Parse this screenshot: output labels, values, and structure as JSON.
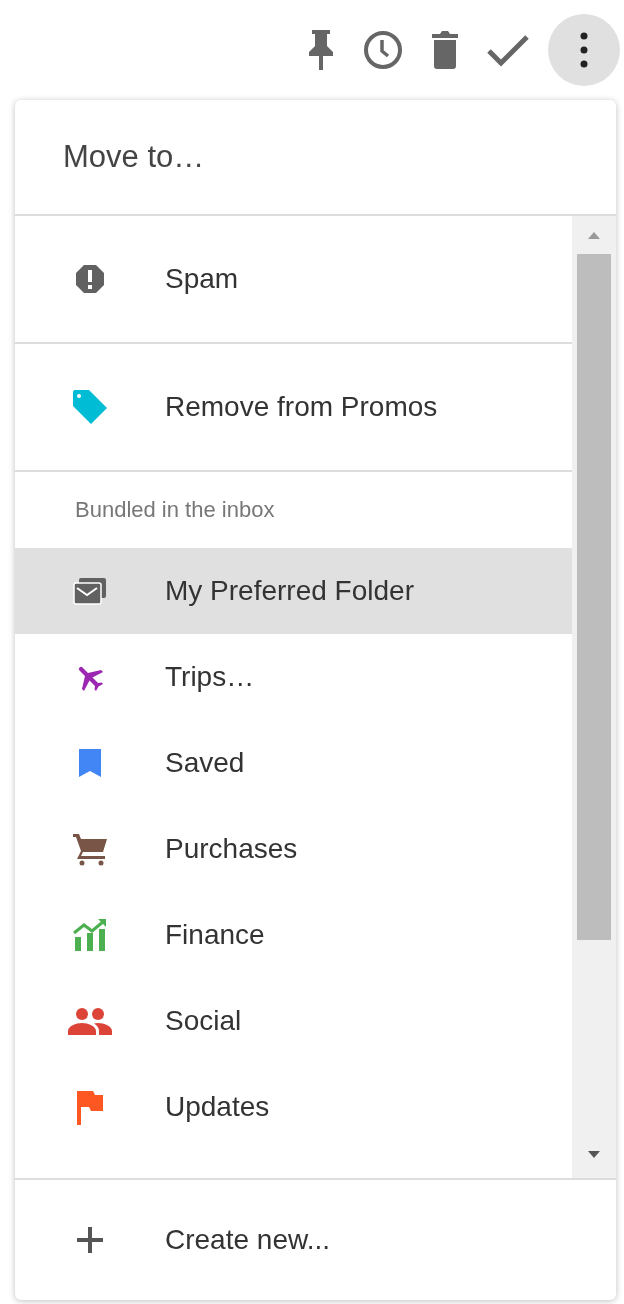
{
  "menu": {
    "title": "Move to…",
    "actions": [
      {
        "label": "Spam",
        "color": "#616161"
      },
      {
        "label": "Remove from Promos",
        "color": "#00bcd4"
      }
    ],
    "section_label": "Bundled in the inbox",
    "folders": [
      {
        "label": "My Preferred Folder",
        "selected": true,
        "color": "#616161"
      },
      {
        "label": "Trips…",
        "selected": false,
        "color": "#9c27b0"
      },
      {
        "label": "Saved",
        "selected": false,
        "color": "#4285f4"
      },
      {
        "label": "Purchases",
        "selected": false,
        "color": "#795548"
      },
      {
        "label": "Finance",
        "selected": false,
        "color": "#4caf50"
      },
      {
        "label": "Social",
        "selected": false,
        "color": "#db4437"
      },
      {
        "label": "Updates",
        "selected": false,
        "color": "#ff5722"
      }
    ],
    "footer": {
      "label": "Create new..."
    }
  }
}
